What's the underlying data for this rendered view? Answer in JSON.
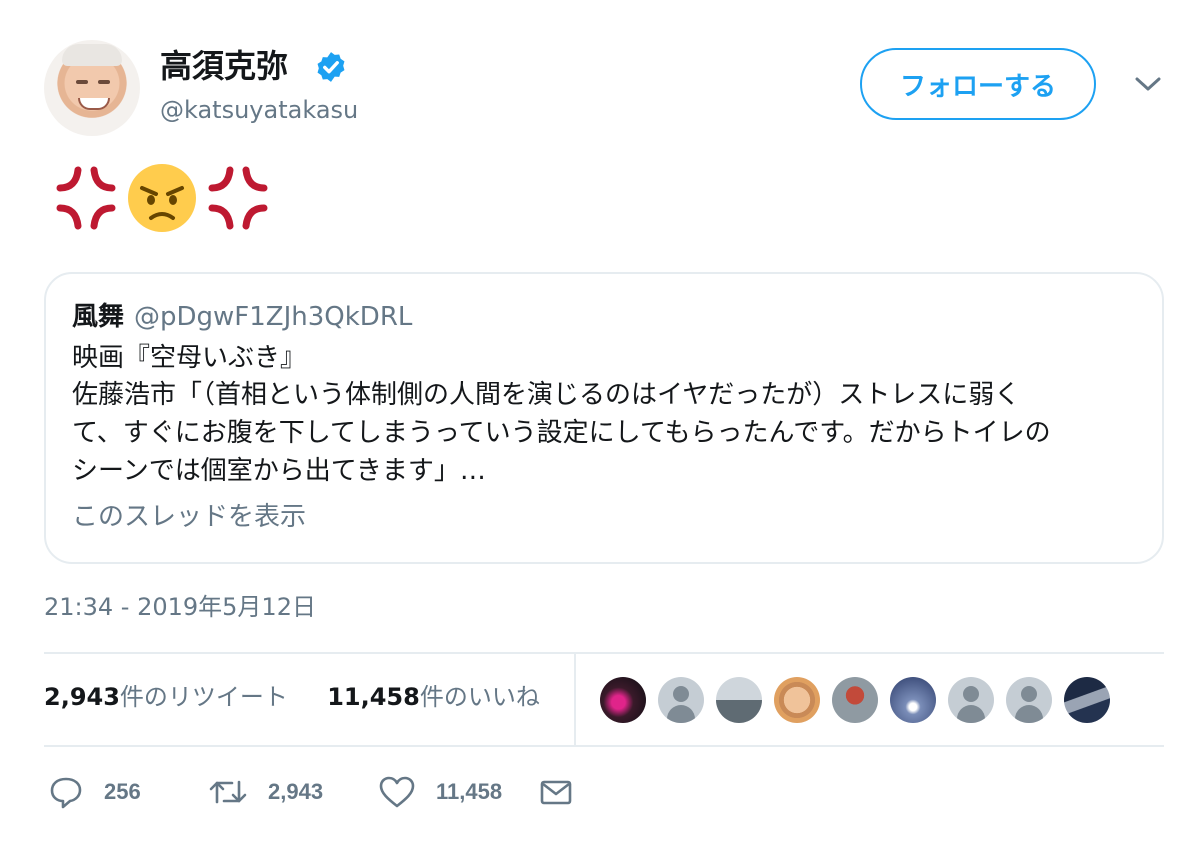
{
  "author": {
    "name": "高須克弥",
    "handle": "@katsuyatakasu",
    "verified": true
  },
  "follow_label": "フォローする",
  "tweet_emojis": [
    "anger-symbol-icon",
    "angry-face-icon",
    "anger-symbol-icon"
  ],
  "quoted_tweet": {
    "name": "風舞",
    "handle": "@pDgwF1ZJh3QkDRL",
    "lines": [
      "映画『空母いぶき』",
      "佐藤浩市「（首相という体制側の人間を演じるのはイヤだったが）ストレスに弱く",
      "て、すぐにお腹を下してしまうっていう設定にしてもらったんです。だからトイレの",
      "シーンでは個室から出てきます」…"
    ],
    "thread_link": "このスレッドを表示"
  },
  "timestamp": "21:34 - 2019年5月12日",
  "stats": {
    "retweets_count": "2,943",
    "retweets_label": "件のリツイート",
    "likes_count": "11,458",
    "likes_label": "件のいいね"
  },
  "actions": {
    "replies": "256",
    "retweets": "2,943",
    "likes": "11,458"
  },
  "colors": {
    "accent": "#1da1f2",
    "muted": "#657786",
    "border": "#e6ecf0",
    "anger": "#be1931",
    "angry_face": "#ffcc4d"
  }
}
